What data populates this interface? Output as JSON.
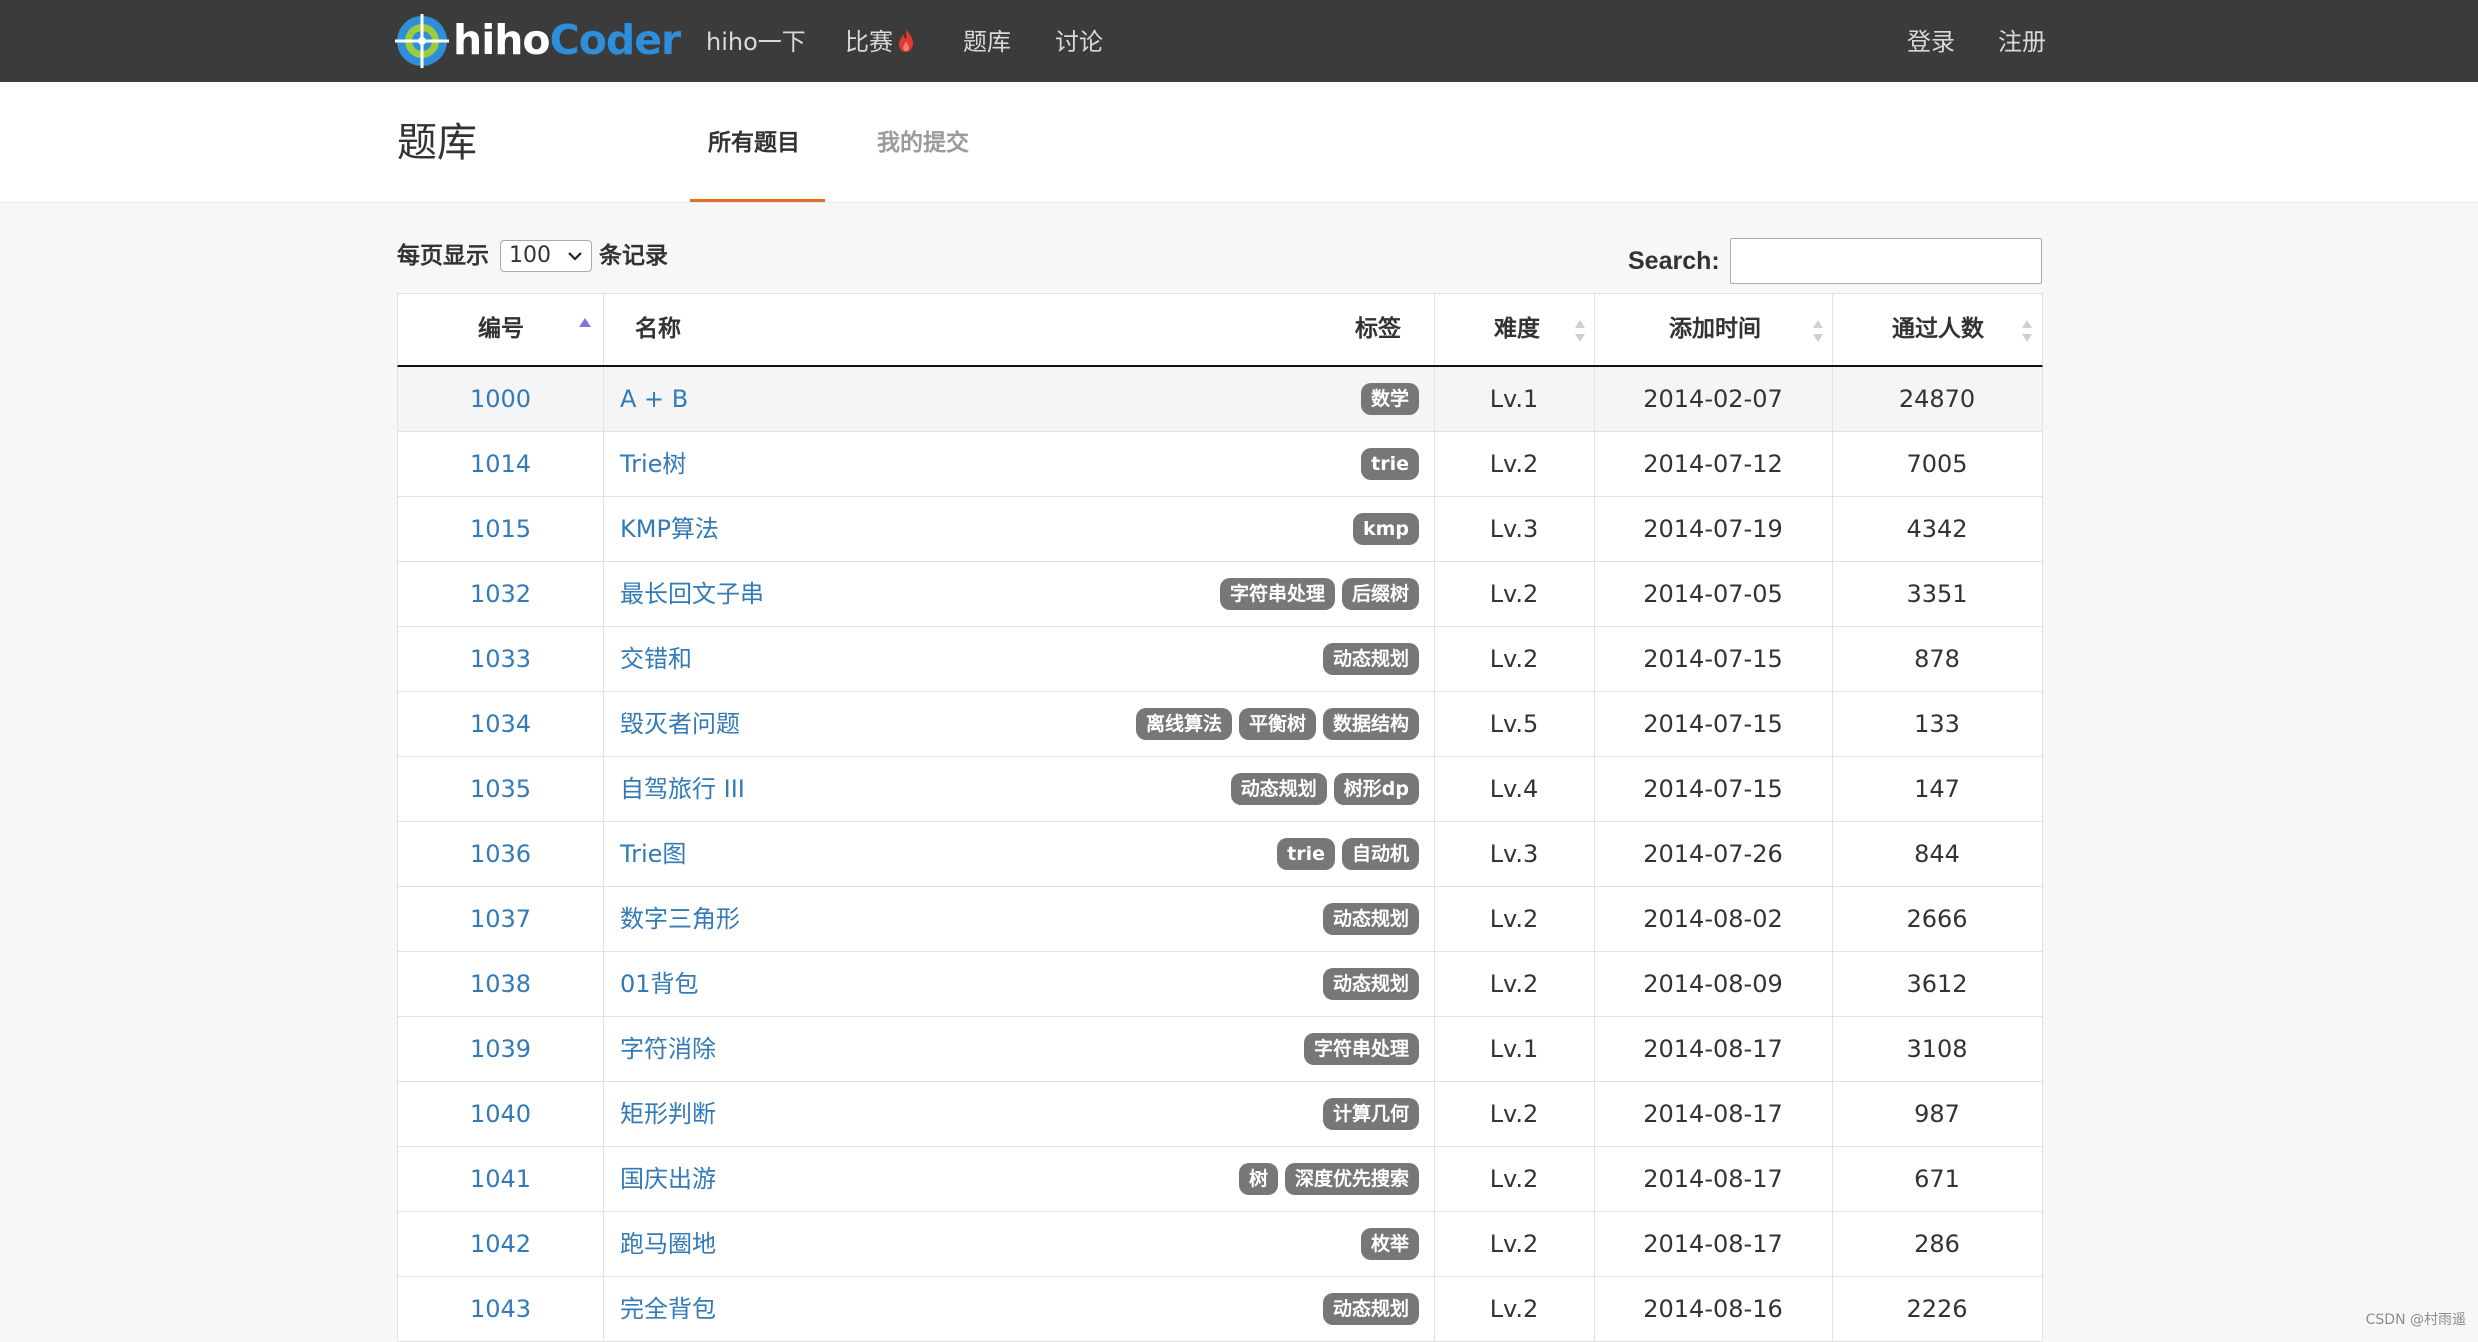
{
  "navbar": {
    "brand_hiho": "hiho",
    "brand_coder": "Coder",
    "links": [
      {
        "label": "hiho一下"
      },
      {
        "label": "比赛"
      },
      {
        "label": "题库"
      },
      {
        "label": "讨论"
      }
    ],
    "login": "登录",
    "register": "注册"
  },
  "header": {
    "title": "题库",
    "tabs": [
      {
        "label": "所有题目",
        "active": true
      },
      {
        "label": "我的提交",
        "active": false
      }
    ]
  },
  "controls": {
    "per_page_prefix": "每页显示",
    "per_page_value": "100",
    "per_page_suffix": "条记录",
    "search_label": "Search:",
    "search_value": ""
  },
  "table": {
    "columns": [
      "编号",
      "名称",
      "标签",
      "难度",
      "添加时间",
      "通过人数"
    ],
    "rows": [
      {
        "id": "1000",
        "name": "A + B",
        "tags": [
          "数学"
        ],
        "level": "Lv.1",
        "date": "2014-02-07",
        "passed": "24870"
      },
      {
        "id": "1014",
        "name": "Trie树",
        "tags": [
          "trie"
        ],
        "level": "Lv.2",
        "date": "2014-07-12",
        "passed": "7005"
      },
      {
        "id": "1015",
        "name": "KMP算法",
        "tags": [
          "kmp"
        ],
        "level": "Lv.3",
        "date": "2014-07-19",
        "passed": "4342"
      },
      {
        "id": "1032",
        "name": "最长回文子串",
        "tags": [
          "字符串处理",
          "后缀树"
        ],
        "level": "Lv.2",
        "date": "2014-07-05",
        "passed": "3351"
      },
      {
        "id": "1033",
        "name": "交错和",
        "tags": [
          "动态规划"
        ],
        "level": "Lv.2",
        "date": "2014-07-15",
        "passed": "878"
      },
      {
        "id": "1034",
        "name": "毁灭者问题",
        "tags": [
          "离线算法",
          "平衡树",
          "数据结构"
        ],
        "level": "Lv.5",
        "date": "2014-07-15",
        "passed": "133"
      },
      {
        "id": "1035",
        "name": "自驾旅行 III",
        "tags": [
          "动态规划",
          "树形dp"
        ],
        "level": "Lv.4",
        "date": "2014-07-15",
        "passed": "147"
      },
      {
        "id": "1036",
        "name": "Trie图",
        "tags": [
          "trie",
          "自动机"
        ],
        "level": "Lv.3",
        "date": "2014-07-26",
        "passed": "844"
      },
      {
        "id": "1037",
        "name": "数字三角形",
        "tags": [
          "动态规划"
        ],
        "level": "Lv.2",
        "date": "2014-08-02",
        "passed": "2666"
      },
      {
        "id": "1038",
        "name": "01背包",
        "tags": [
          "动态规划"
        ],
        "level": "Lv.2",
        "date": "2014-08-09",
        "passed": "3612"
      },
      {
        "id": "1039",
        "name": "字符消除",
        "tags": [
          "字符串处理"
        ],
        "level": "Lv.1",
        "date": "2014-08-17",
        "passed": "3108"
      },
      {
        "id": "1040",
        "name": "矩形判断",
        "tags": [
          "计算几何"
        ],
        "level": "Lv.2",
        "date": "2014-08-17",
        "passed": "987"
      },
      {
        "id": "1041",
        "name": "国庆出游",
        "tags": [
          "树",
          "深度优先搜索"
        ],
        "level": "Lv.2",
        "date": "2014-08-17",
        "passed": "671"
      },
      {
        "id": "1042",
        "name": "跑马圈地",
        "tags": [
          "枚举"
        ],
        "level": "Lv.2",
        "date": "2014-08-17",
        "passed": "286"
      },
      {
        "id": "1043",
        "name": "完全背包",
        "tags": [
          "动态规划"
        ],
        "level": "Lv.2",
        "date": "2014-08-16",
        "passed": "2226"
      }
    ]
  },
  "watermark": "CSDN @村雨遥",
  "colors": {
    "navbar_bg": "#3b3b3b",
    "link_blue": "#337ab7",
    "tag_bg": "#777777",
    "tab_accent": "#e4701e",
    "brand_blue": "#2f8ed9"
  },
  "icons": {
    "logo": "hihocoder-target-logo",
    "contest_badge": "fire-icon",
    "sort_active": "sort-asc-icon",
    "sort_inactive": "sort-both-icon",
    "select_arrow": "chevron-down-icon"
  }
}
